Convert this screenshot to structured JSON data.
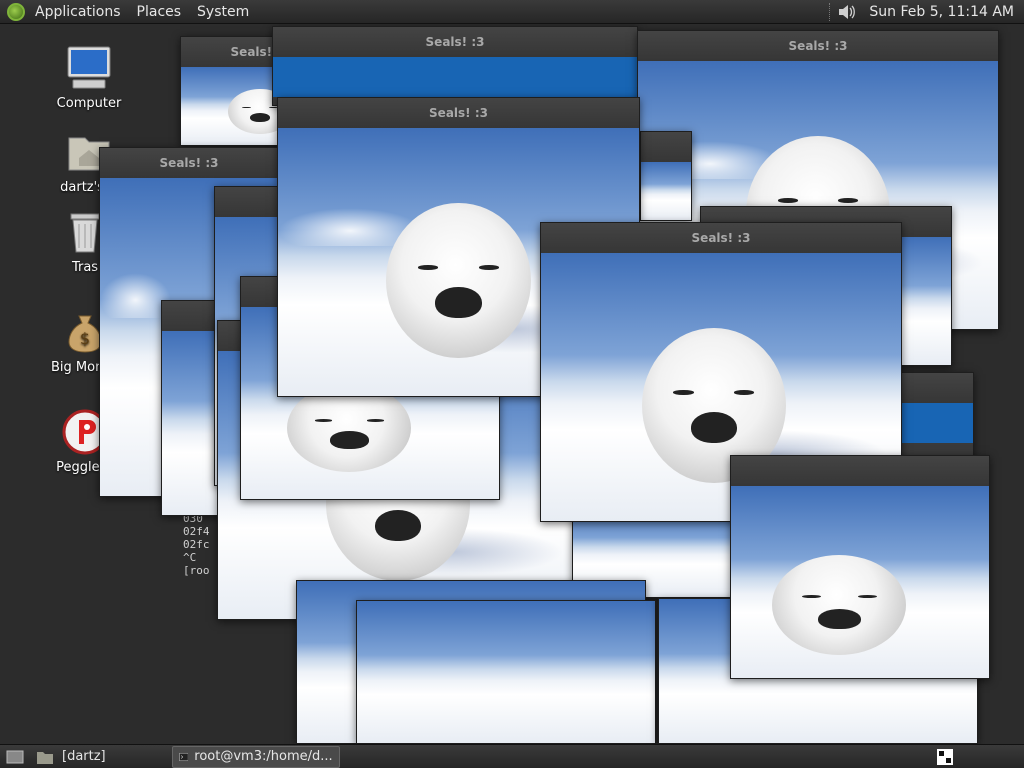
{
  "top_panel": {
    "menus": [
      "Applications",
      "Places",
      "System"
    ],
    "clock": "Sun Feb  5, 11:14 AM"
  },
  "desktop_icons": [
    {
      "label": "Computer",
      "icon": "computer-icon"
    },
    {
      "label": "dartz's H",
      "icon": "home-folder-icon"
    },
    {
      "label": "Tras",
      "icon": "trash-icon"
    },
    {
      "label": "Big Money",
      "icon": "money-bag-icon"
    },
    {
      "label": "Peggle D",
      "icon": "peggle-icon"
    }
  ],
  "window_title": "Seals! :3",
  "terminal_lines": [
    "030",
    "02f4",
    "02fc",
    "^C",
    "[roo"
  ],
  "bottom_panel": {
    "workspace_label": "[dartz]",
    "task_label": "root@vm3:/home/d..."
  },
  "colors": {
    "panel": "#2f2f2f",
    "titlebar": "#3c3c3c",
    "title_text": "#a8a8a8",
    "accent_blue": "#1865b4"
  }
}
